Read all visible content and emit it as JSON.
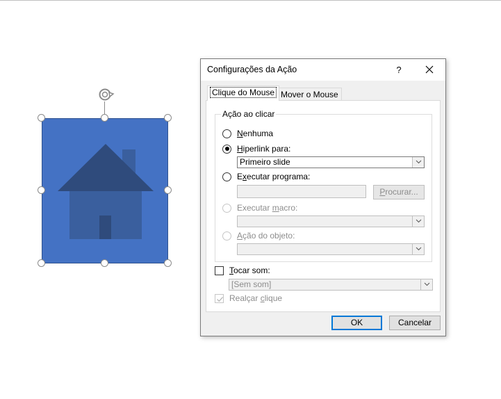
{
  "slide": {
    "shape_name": "house-picture",
    "colors": {
      "fill": "#4472c4",
      "roof": "#2f4b7c",
      "body": "#3a5f9e",
      "door": "#2f4b7c"
    }
  },
  "dialog": {
    "title": "Configurações da Ação",
    "help_label": "?",
    "tabs": [
      {
        "label": "Clique do Mouse",
        "active": true
      },
      {
        "label": "Mover o Mouse",
        "active": false
      }
    ],
    "group_label": "Ação ao clicar",
    "options": {
      "none": {
        "pre": "",
        "key": "N",
        "post": "enhuma",
        "checked": false,
        "enabled": true
      },
      "hyperlink": {
        "pre": "",
        "key": "H",
        "post": "iperlink para:",
        "checked": true,
        "enabled": true
      },
      "run_program": {
        "pre": "E",
        "key": "x",
        "post": "ecutar programa:",
        "checked": false,
        "enabled": true
      },
      "run_macro": {
        "pre": "Executar ",
        "key": "m",
        "post": "acro:",
        "checked": false,
        "enabled": false
      },
      "object_action": {
        "pre": "",
        "key": "A",
        "post": "ção do objeto:",
        "checked": false,
        "enabled": false
      }
    },
    "hyperlink_value": "Primeiro slide",
    "program_value": "",
    "browse_button": {
      "key": "P",
      "post": "rocurar..."
    },
    "macro_value": "",
    "object_action_value": "",
    "play_sound": {
      "key": "T",
      "post": "ocar som:",
      "checked": false
    },
    "sound_value": "[Sem som]",
    "highlight_click": {
      "pre": "Realçar ",
      "key": "c",
      "post": "lique",
      "checked": true,
      "enabled": false
    },
    "ok_label": "OK",
    "cancel_label": "Cancelar",
    "accent_color": "#0078d7"
  }
}
